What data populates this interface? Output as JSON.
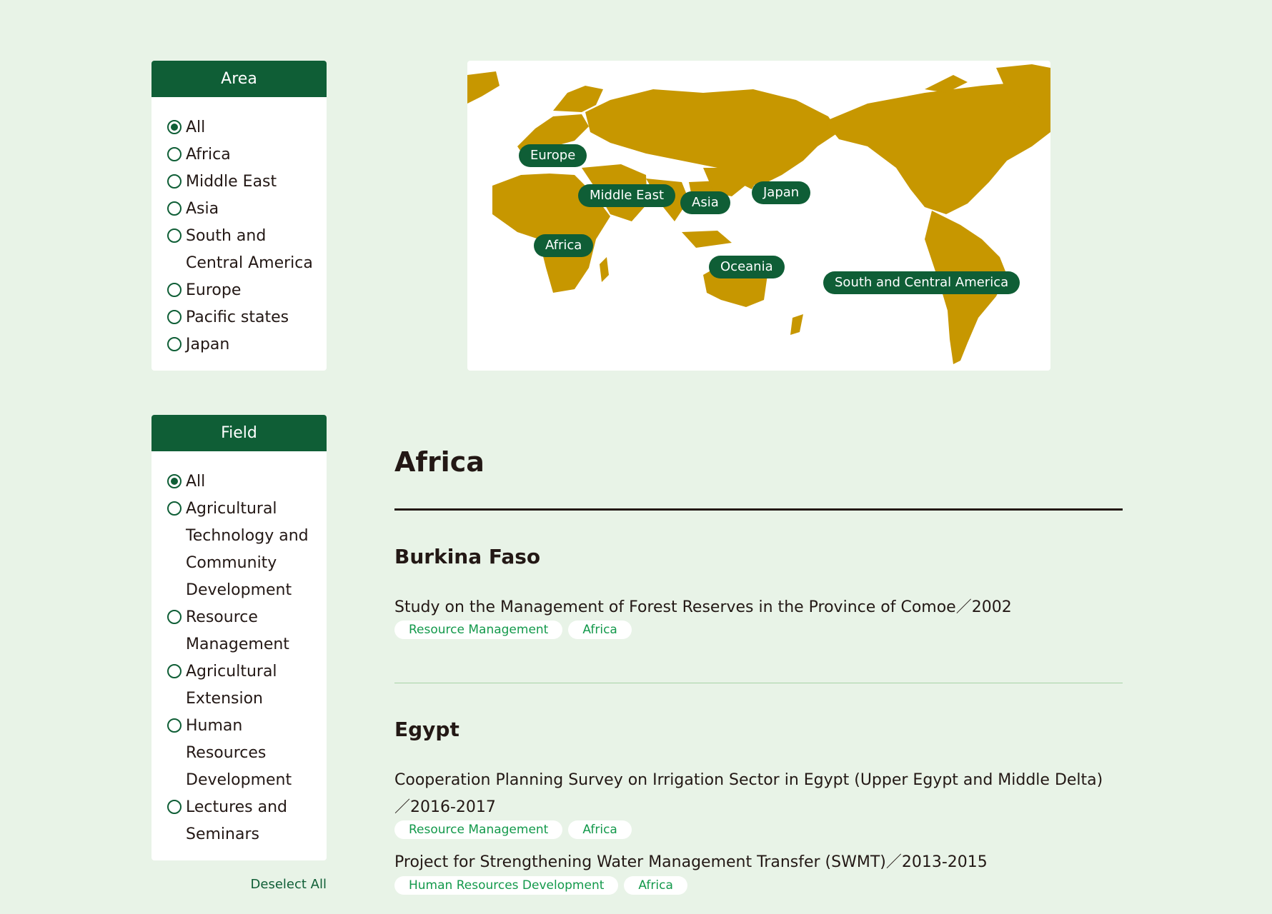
{
  "area": {
    "title": "Area",
    "options": [
      "All",
      "Africa",
      "Middle East",
      "Asia",
      "South and",
      "Central America",
      "Europe",
      "Pacific states",
      "Japan"
    ],
    "selected": "All"
  },
  "field": {
    "title": "Field",
    "options": [
      "All",
      "Agricultural",
      "Technology and",
      "Community",
      "Development",
      "Resource",
      "Management",
      "Agricultural",
      "Extension",
      "Human",
      "Resources",
      "Development",
      "Lectures and",
      "Seminars"
    ],
    "selected": "All",
    "deselect_label": "Deselect All"
  },
  "map": {
    "labels": [
      "Europe",
      "Middle East",
      "Asia",
      "Japan",
      "Africa",
      "Oceania",
      "South and Central America"
    ],
    "land_color": "#c79700",
    "label_color": "#0f5e36"
  },
  "content": {
    "region_title": "Africa",
    "countries": [
      {
        "name": "Burkina Faso",
        "projects": [
          {
            "title": "Study on the Management of Forest Reserves in the Province of Comoe／2002",
            "tags": [
              "Resource Management",
              "Africa"
            ]
          }
        ]
      },
      {
        "name": "Egypt",
        "projects": [
          {
            "title": "Cooperation Planning Survey on Irrigation Sector in Egypt (Upper Egypt and Middle Delta)／2016-2017",
            "tags": [
              "Resource Management",
              "Africa"
            ]
          },
          {
            "title": "Project for Strengthening Water Management Transfer (SWMT)／2013-2015",
            "tags": [
              "Human Resources Development",
              "Africa"
            ]
          }
        ]
      }
    ]
  }
}
